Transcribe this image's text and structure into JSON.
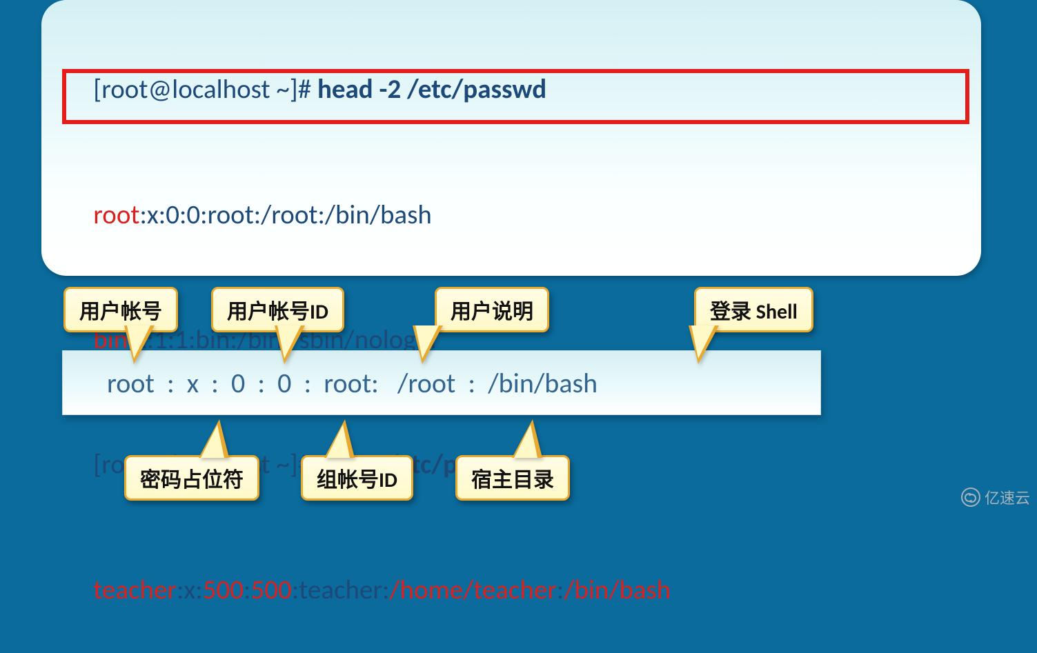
{
  "terminal": {
    "prompt1_pre": "[root@localhost ~]# ",
    "cmd1": "head -2 /etc/passwd",
    "line_root_red": "root",
    "line_root_rest": ":x:0:0:root:/root:/bin/bash",
    "line_bin_red": "bin",
    "line_bin_rest": ":x:1:1:bin:/bin:/sbin/nologin",
    "prompt2_pre": "[root@localhost ~]# ",
    "cmd2": "tail -1 /etc/passwd",
    "teacher_a": "teacher",
    "teacher_b": ":x:",
    "teacher_c": "500",
    "teacher_d": ":",
    "teacher_e": "500",
    "teacher_f": ":teacher:",
    "teacher_g": "/home/teacher",
    "teacher_h": ":",
    "teacher_i": "/bin/bash"
  },
  "example": "root  :  x  :  0  :  0  :  root:   /root  :  /bin/bash",
  "labels": {
    "user_account": "用户帐号",
    "user_account_id": "用户帐号ID",
    "user_desc": "用户说明",
    "login_shell": "登录 Shell",
    "pw_placeholder": "密码占位符",
    "group_id": "组帐号ID",
    "home_dir": "宿主目录"
  },
  "watermark": "亿速云"
}
